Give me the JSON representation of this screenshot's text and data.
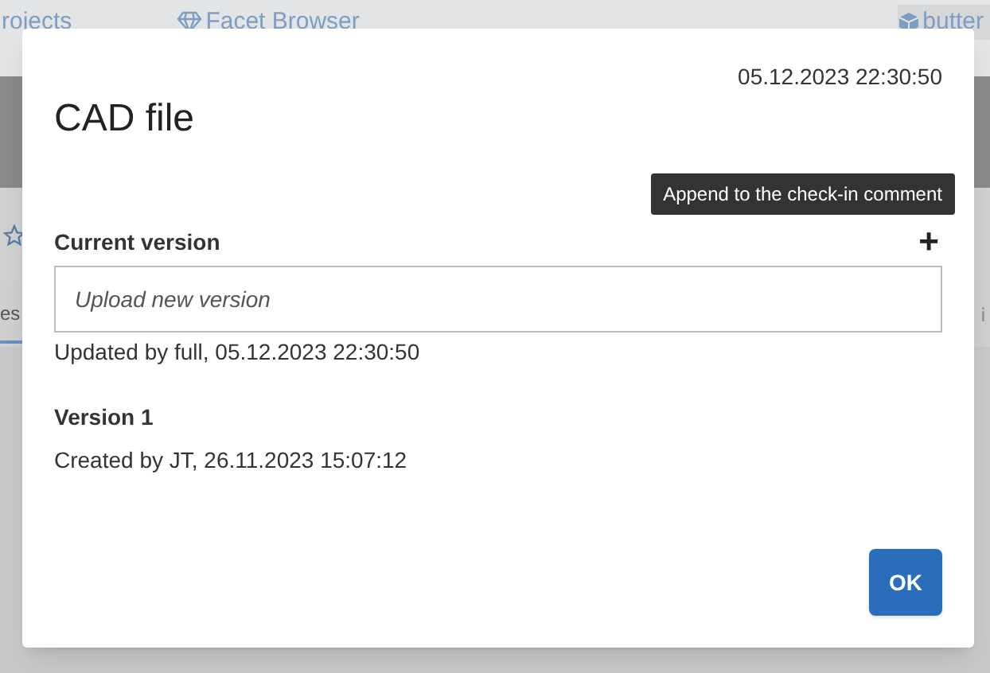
{
  "background": {
    "nav": [
      {
        "label": "rojects"
      },
      {
        "label": "Facet Browser"
      },
      {
        "label": "butter"
      }
    ],
    "tabs": [
      {
        "label": "es",
        "selected": true
      },
      {
        "label": "i",
        "selected": false
      }
    ]
  },
  "dialog": {
    "title": "CAD file",
    "timestamp": "05.12.2023 22:30:50",
    "tooltip": "Append to the check-in comment",
    "current_version": {
      "label": "Current version",
      "add_button": "+",
      "field": {
        "placeholder": "Upload new version"
      },
      "note": "Updated by full, 05.12.2023 22:30:50"
    },
    "versions": [
      {
        "label": "Version 1",
        "note": "Created by JT, 26.11.2023 15:07:12"
      }
    ],
    "buttons": [
      "OK"
    ]
  }
}
